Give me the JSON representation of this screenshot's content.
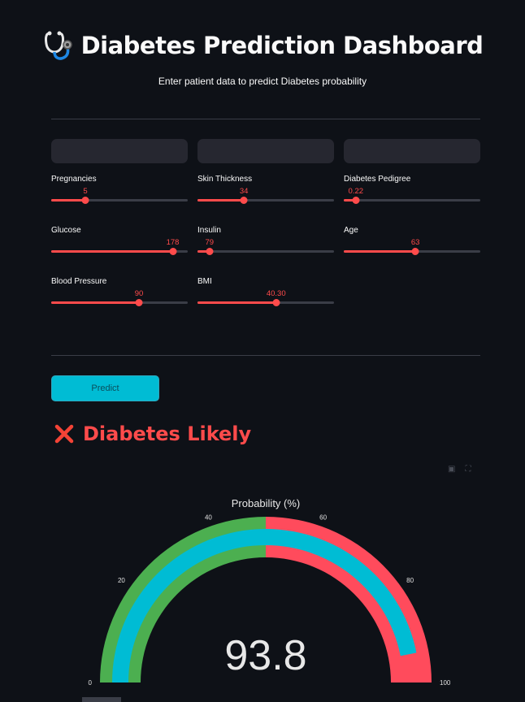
{
  "header": {
    "title_icon": "stethoscope-icon",
    "title": "Diabetes Prediction Dashboard",
    "subtitle": "Enter patient data to predict Diabetes probability"
  },
  "inputs": {
    "pregnancies": {
      "label": "Pregnancies",
      "value": "5",
      "min": 0,
      "max": 20,
      "num": 5
    },
    "glucose": {
      "label": "Glucose",
      "value": "178",
      "min": 0,
      "max": 200,
      "num": 178
    },
    "blood_pressure": {
      "label": "Blood Pressure",
      "value": "90",
      "min": 0,
      "max": 140,
      "num": 90
    },
    "skin_thickness": {
      "label": "Skin Thickness",
      "value": "34",
      "min": 0,
      "max": 100,
      "num": 34
    },
    "insulin": {
      "label": "Insulin",
      "value": "79",
      "min": 0,
      "max": 900,
      "num": 79
    },
    "bmi": {
      "label": "BMI",
      "value": "40.30",
      "min": 0,
      "max": 70,
      "num": 40.3
    },
    "diabetes_pedigree": {
      "label": "Diabetes Pedigree",
      "value": "0.22",
      "min": 0,
      "max": 2.5,
      "num": 0.22
    },
    "age": {
      "label": "Age",
      "value": "63",
      "min": 0,
      "max": 120,
      "num": 63
    }
  },
  "predict_button": {
    "label": "Predict"
  },
  "result": {
    "icon": "cross-mark-icon",
    "text": "Diabetes Likely",
    "color": "#ff4b4b"
  },
  "toolbar": {
    "icons": [
      "camera-icon",
      "fullscreen-icon"
    ]
  },
  "chart_data": {
    "type": "gauge",
    "title": "Probability (%)",
    "value": 93.8,
    "value_text": "93.8",
    "range": [
      0,
      100
    ],
    "ticks": [
      "0",
      "20",
      "40",
      "60",
      "80",
      "100"
    ],
    "tick_values": [
      0,
      20,
      40,
      60,
      80,
      100
    ],
    "steps": [
      {
        "range": [
          0,
          50
        ],
        "color": "#4caf50"
      },
      {
        "range": [
          50,
          100
        ],
        "color": "#ff4b5c"
      }
    ],
    "bar_color": "#00bcd4"
  },
  "colors": {
    "background": "#0e1117",
    "accent": "#ff4b4b",
    "button": "#00bcd4",
    "track": "#3a3d47"
  }
}
